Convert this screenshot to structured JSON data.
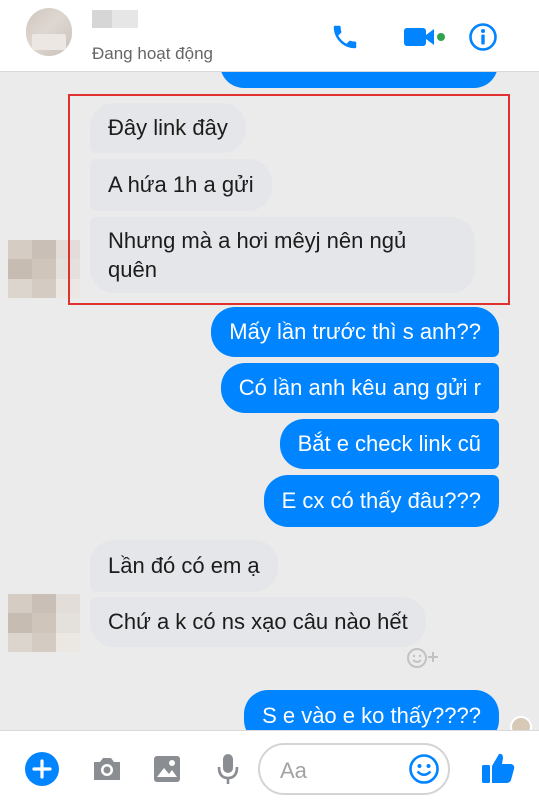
{
  "header": {
    "status": "Đang hoạt động",
    "icons": [
      "phone-icon",
      "video-call-icon",
      "info-icon"
    ],
    "active_dot_color": "#31a24c"
  },
  "messages": [
    {
      "side": "in",
      "text": "Đây link đây"
    },
    {
      "side": "in",
      "text": "A hứa 1h a gửi"
    },
    {
      "side": "in",
      "lines": [
        "Nhưng mà a hơi mêyj nên ngủ",
        "quên"
      ]
    },
    {
      "side": "out",
      "text": "Mấy lần trước thì s anh??"
    },
    {
      "side": "out",
      "text": "Có lần anh kêu ang gửi r"
    },
    {
      "side": "out",
      "text": "Bắt e check link cũ"
    },
    {
      "side": "out",
      "text": "E cx có thấy đâu???"
    },
    {
      "side": "in",
      "text": "Lần đó có em ạ"
    },
    {
      "side": "in",
      "text": "Chứ a k có ns xạo câu nào hết"
    },
    {
      "side": "out",
      "text": "S e vào e ko thấy????"
    }
  ],
  "composer": {
    "placeholder": "Aa",
    "icons": [
      "plus-icon",
      "camera-icon",
      "image-icon",
      "microphone-icon",
      "emoji-icon",
      "thumbs-up-icon"
    ]
  },
  "colors": {
    "accent": "#0084ff",
    "incoming_bubble": "#e4e6e9",
    "highlight_border": "#e0302f"
  }
}
